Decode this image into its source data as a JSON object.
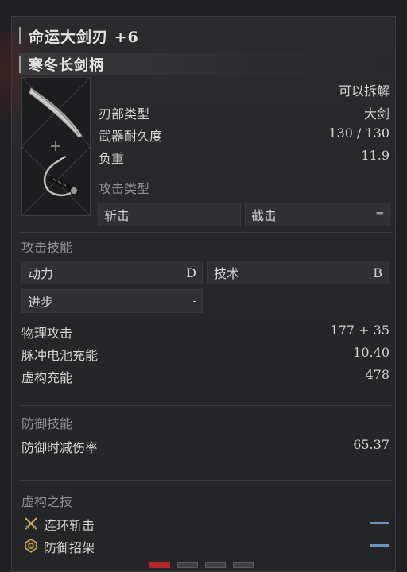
{
  "item": {
    "title": "命运大剑刃 +6",
    "subtitle": "寒冬长剑柄",
    "dismantle": "可以拆解"
  },
  "stats_top": [
    {
      "label": "刃部类型",
      "value": "大剑"
    },
    {
      "label": "武器耐久度",
      "value": "130 / 130"
    },
    {
      "label": "负重",
      "value": "11.9"
    }
  ],
  "attack_type": {
    "header": "攻击类型",
    "cells": [
      {
        "label": "斩击",
        "value": "-"
      },
      {
        "label": "截击",
        "value": "═"
      }
    ]
  },
  "attack_skill": {
    "header": "攻击技能",
    "cells": [
      {
        "label": "动力",
        "value": "D"
      },
      {
        "label": "技术",
        "value": "B"
      },
      {
        "label": "进步",
        "value": "-"
      }
    ]
  },
  "stats_mid": [
    {
      "label": "物理攻击",
      "value": "177 + 35"
    },
    {
      "label": "脉冲电池充能",
      "value": "10.40"
    },
    {
      "label": "虚构充能",
      "value": "478"
    }
  ],
  "defense": {
    "header": "防御技能",
    "label": "防御时减伤率",
    "value": "65.37"
  },
  "fable": {
    "header": "虚构之技",
    "skills": [
      {
        "label": "连环斩击",
        "icon": "crossed-swords-icon"
      },
      {
        "label": "防御招架",
        "icon": "shield-icon"
      }
    ]
  },
  "pager": {
    "count": 4,
    "active": 1
  },
  "colors": {
    "accent_red": "#b7262c",
    "skill_blue": "#6f95b8"
  }
}
